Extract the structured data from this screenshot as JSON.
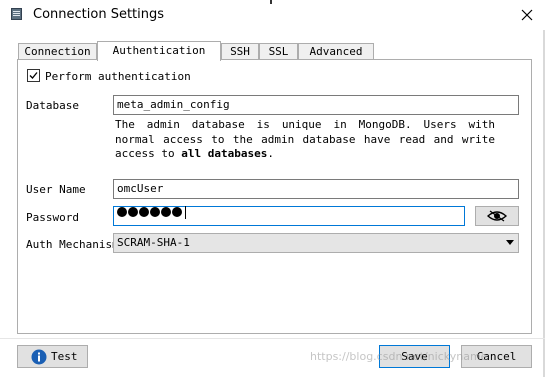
{
  "window": {
    "title": "Connection Settings",
    "close_icon": "close-icon",
    "app_icon": "window-app-icon"
  },
  "tabs": [
    {
      "label": "Connection",
      "active": false
    },
    {
      "label": "Authentication",
      "active": true
    },
    {
      "label": "SSH",
      "active": false
    },
    {
      "label": "SSL",
      "active": false
    },
    {
      "label": "Advanced",
      "active": false
    }
  ],
  "auth": {
    "perform_label": "Perform authentication",
    "perform_checked": true,
    "database_label": "Database",
    "database_value": "meta_admin_config",
    "hint_part1": "The  admin  database  is  unique  in  MongoDB. Users with normal access to the admin database have read and write access to ",
    "hint_bold1": "all databases",
    "hint_part2": ".",
    "user_label": "User Name",
    "user_value": "omcUser",
    "password_label": "Password",
    "password_masked_count": 6,
    "eye_icon": "eye-icon",
    "mechanism_label": "Auth Mechanism",
    "mechanism_value": "SCRAM-SHA-1",
    "mechanism_icon": "chevron-down-icon"
  },
  "buttons": {
    "test_label": "Test",
    "test_icon": "info-icon",
    "save_label": "Save",
    "cancel_label": "Cancel"
  },
  "watermark": "https://blog.csdn.net/nickyname",
  "colors": {
    "focus_border": "#0078d7",
    "info_icon": "#1a5fb4",
    "button_bg": "#e1e1e1"
  }
}
